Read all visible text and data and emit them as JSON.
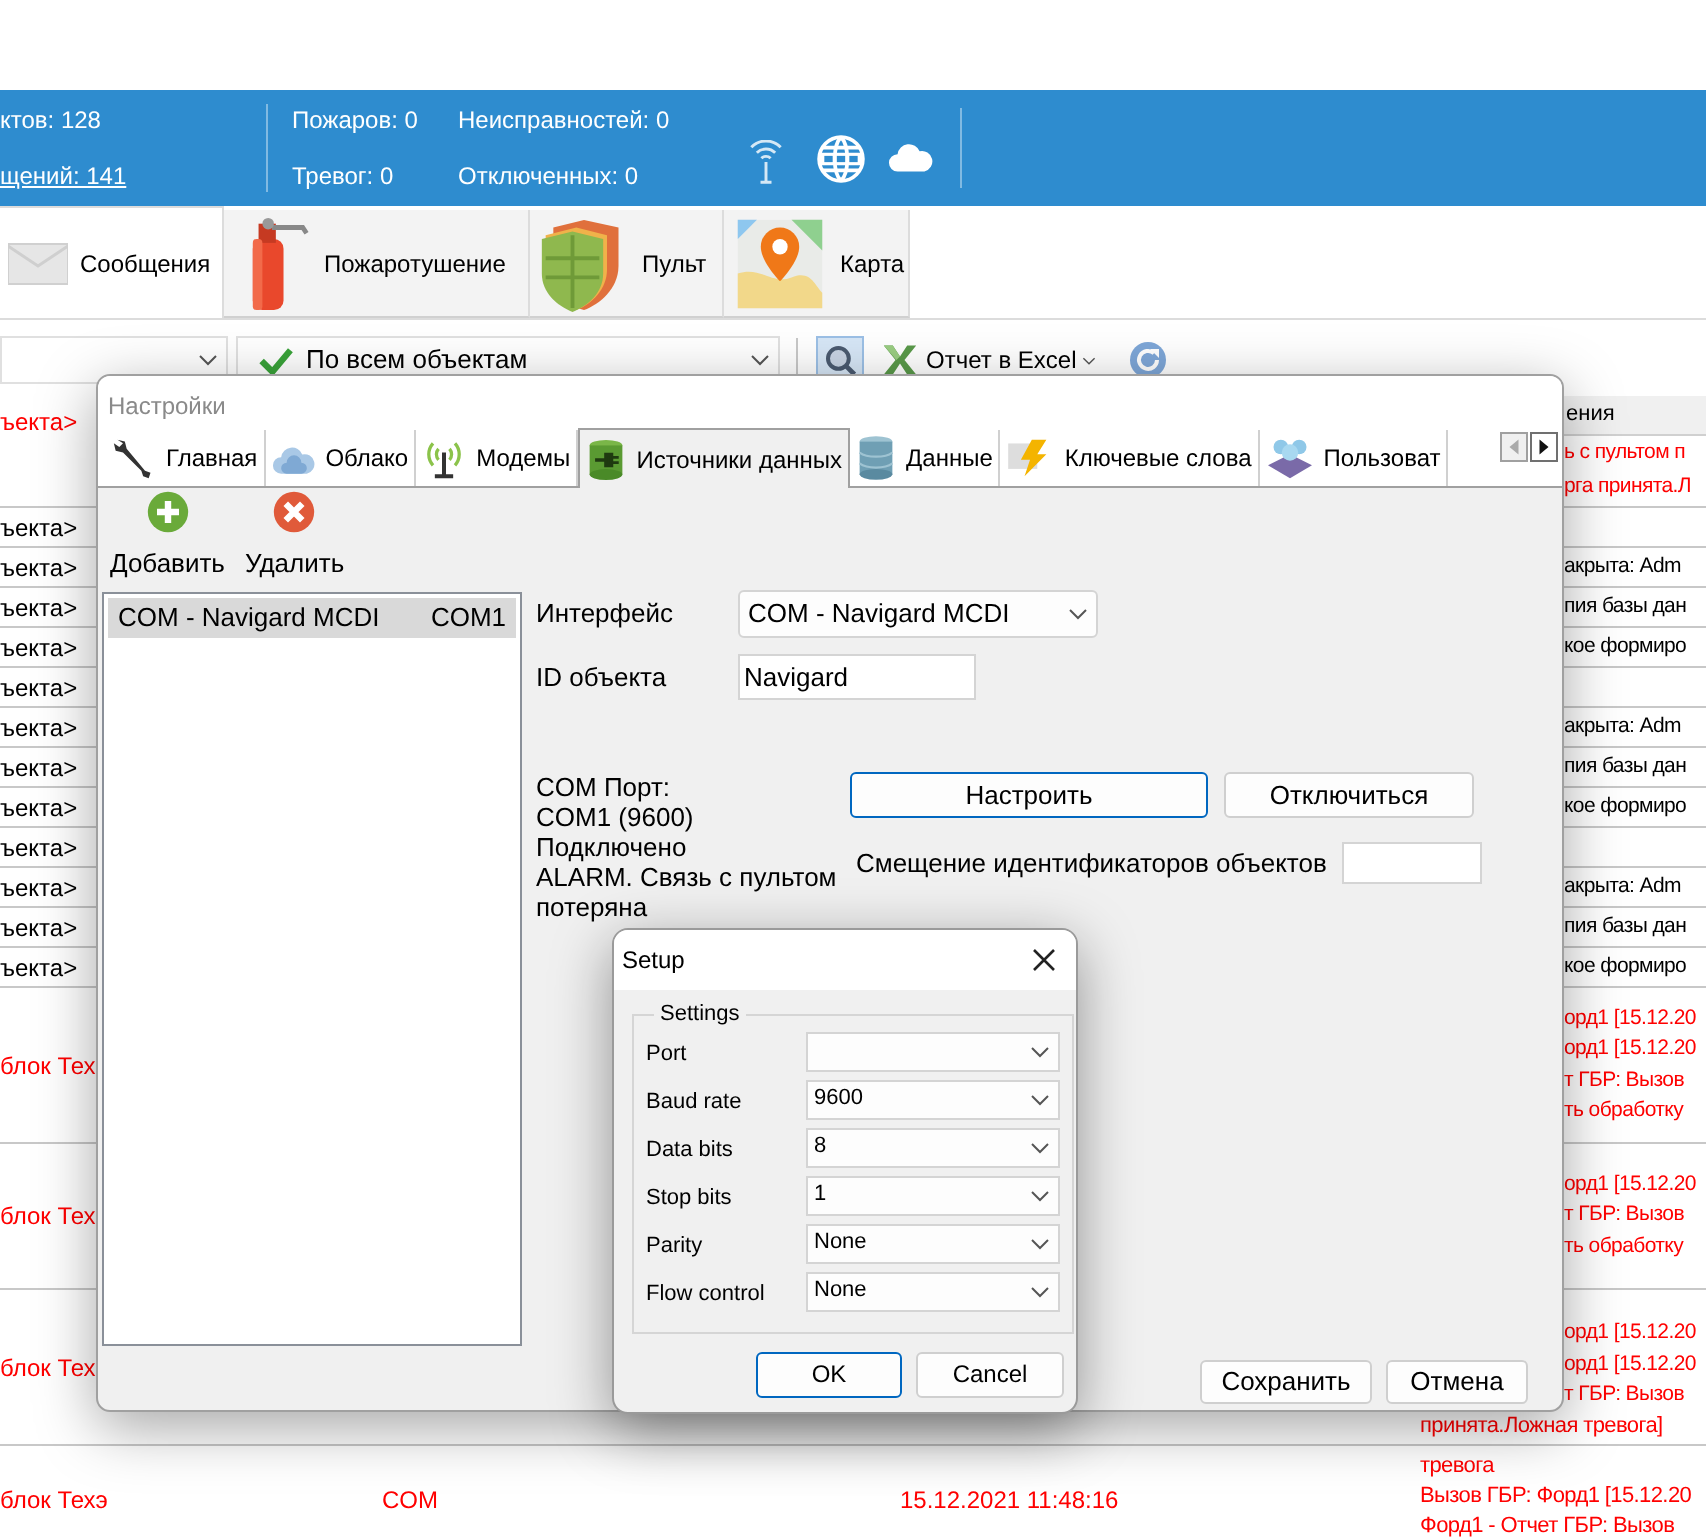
{
  "status_header": {
    "objects": "ктов: 128",
    "messages": "щений: 141",
    "fires": "Пожаров: 0",
    "alarms": "Тревог: 0",
    "faults": "Неисправностей: 0",
    "disabled": "Отключенных: 0"
  },
  "ribbon_tabs": [
    {
      "label": "Сообщения",
      "selected": true
    },
    {
      "label": "Пожаротушение",
      "selected": false
    },
    {
      "label": "Пульт",
      "selected": false
    },
    {
      "label": "Карта",
      "selected": false
    }
  ],
  "toolbar": {
    "object_filter": "По всем объектам",
    "export": "Отчет в Excel"
  },
  "table": {
    "column_header": "ения",
    "rows": [
      {
        "column_1": "ъекта>",
        "column_4": [
          "ь с пультом п",
          "рга принята.Л"
        ],
        "color": "#ff0000"
      },
      {
        "column_1": "ъекта>",
        "color": "#000000"
      },
      {
        "column_1": "ъекта>",
        "column_4": [
          "акрыта: Adm"
        ],
        "color": "#000000"
      },
      {
        "column_1": "ъекта>",
        "column_4": [
          "пия базы дан"
        ],
        "color": "#000000"
      },
      {
        "column_1": "ъекта>",
        "column_4": [
          "кое формиро"
        ],
        "color": "#000000"
      },
      {
        "column_1": "ъекта>",
        "color": "#000000"
      },
      {
        "column_1": "ъекта>",
        "column_4": [
          "акрыта: Adm"
        ],
        "color": "#000000"
      },
      {
        "column_1": "ъекта>",
        "column_4": [
          "пия базы дан"
        ],
        "color": "#000000"
      },
      {
        "column_1": "ъекта>",
        "column_4": [
          "кое формиро"
        ],
        "color": "#000000"
      },
      {
        "column_1": "ъекта>",
        "color": "#000000"
      },
      {
        "column_1": "ъекта>",
        "column_4": [
          "акрыта: Adm"
        ],
        "color": "#000000"
      },
      {
        "column_1": "ъекта>",
        "column_4": [
          "пия базы дан"
        ],
        "color": "#000000"
      },
      {
        "column_1": "ъекта>",
        "column_4": [
          "кое формиро"
        ],
        "color": "#000000"
      },
      {
        "column_1": "блок Тех",
        "column_4": [
          "орд1 [15.12.20",
          "орд1 [15.12.20",
          "т ГБР: Вызов",
          "ть обработку"
        ],
        "color": "#ff0000"
      },
      {
        "column_1": "блок Тех",
        "column_4": [
          "орд1 [15.12.20",
          "т ГБР: Вызов",
          "ть обработку"
        ],
        "color": "#ff0000"
      },
      {
        "column_1": "блок Тех",
        "column_4": [
          "орд1 [15.12.20",
          "орд1 [15.12.20",
          "т ГБР: Вызов",
          "принята.Ложная тревога]"
        ],
        "color": "#ff0000"
      },
      {
        "column_1": "блок Техэ",
        "column_2": "COM",
        "column_3": "15.12.2021 11:48:16",
        "column_4": [
          "тревога",
          "Вызов ГБР: Форд1 [15.12.20",
          "Форд1 - Отчет ГБР: Вызов"
        ],
        "color": "#ff0000"
      }
    ]
  },
  "settings_dialog": {
    "title": "Настройки",
    "tabs": [
      {
        "label": "Главная",
        "selected": false
      },
      {
        "label": "Облако",
        "selected": false
      },
      {
        "label": "Модемы",
        "selected": false
      },
      {
        "label": "Источники данных",
        "selected": true
      },
      {
        "label": "Данные",
        "selected": false
      },
      {
        "label": "Ключевые слова",
        "selected": false
      },
      {
        "label": "Пользоват",
        "selected": false
      }
    ],
    "actions": [
      "Добавить",
      "Удалить"
    ],
    "sources": [
      {
        "name": "COM - Navigard MCDI",
        "port": "COM1",
        "selected": true
      }
    ],
    "interface_label": "Интерфейс",
    "interface_value": "COM - Navigard MCDI",
    "object_id_label": "ID объекта",
    "object_id_value": "Navigard",
    "status_lines": [
      "COM Порт:",
      "COM1 (9600)",
      "Подключено",
      "ALARM. Связь с пультом потеряна"
    ],
    "buttons": [
      {
        "label": "Настроить",
        "focused": true
      },
      {
        "label": "Отключиться",
        "focused": false
      }
    ],
    "offset_label": "Смещение идентификаторов объектов",
    "footer_buttons": [
      {
        "label": "Сохранить",
        "focused": false
      },
      {
        "label": "Отмена",
        "focused": false
      }
    ]
  },
  "setup_dialog": {
    "title": "Setup",
    "group": "Settings",
    "fields": [
      {
        "label": "Port"
      },
      {
        "label": "Baud rate",
        "value": "9600"
      },
      {
        "label": "Data bits",
        "value": "8"
      },
      {
        "label": "Stop bits",
        "value": "1"
      },
      {
        "label": "Parity",
        "value": "None"
      },
      {
        "label": "Flow control",
        "value": "None"
      }
    ],
    "buttons": [
      {
        "label": "OK",
        "focused": true
      },
      {
        "label": "Cancel",
        "focused": false
      }
    ]
  }
}
